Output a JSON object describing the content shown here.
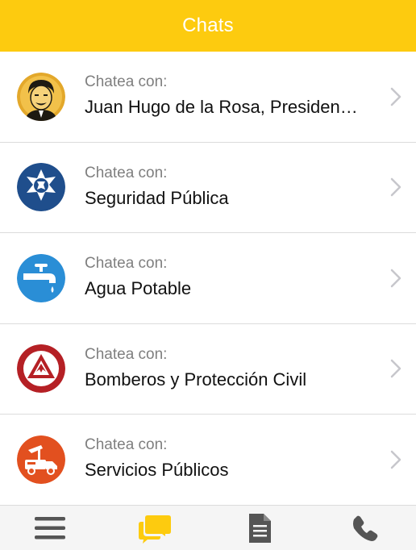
{
  "header": {
    "title": "Chats"
  },
  "chats": [
    {
      "caption": "Chatea con:",
      "name": "Juan Hugo de la Rosa, Presidente Municipal",
      "icon": "portrait-icon"
    },
    {
      "caption": "Chatea con:",
      "name": "Seguridad Pública",
      "icon": "police-star-icon"
    },
    {
      "caption": "Chatea con:",
      "name": "Agua Potable",
      "icon": "water-faucet-icon"
    },
    {
      "caption": "Chatea con:",
      "name": "Bomberos y Protección Civil",
      "icon": "firefighter-icon"
    },
    {
      "caption": "Chatea con:",
      "name": "Servicios Públicos",
      "icon": "service-truck-icon"
    }
  ],
  "tabbar": {
    "items": [
      {
        "icon": "menu-icon",
        "active": false
      },
      {
        "icon": "chat-bubbles-icon",
        "active": true
      },
      {
        "icon": "document-icon",
        "active": false
      },
      {
        "icon": "phone-icon",
        "active": false
      }
    ]
  },
  "colors": {
    "header": "#fdcb0f",
    "active_tab": "#fdcb0f",
    "inactive_tab": "#555555",
    "chevron": "#c7c7cc"
  }
}
